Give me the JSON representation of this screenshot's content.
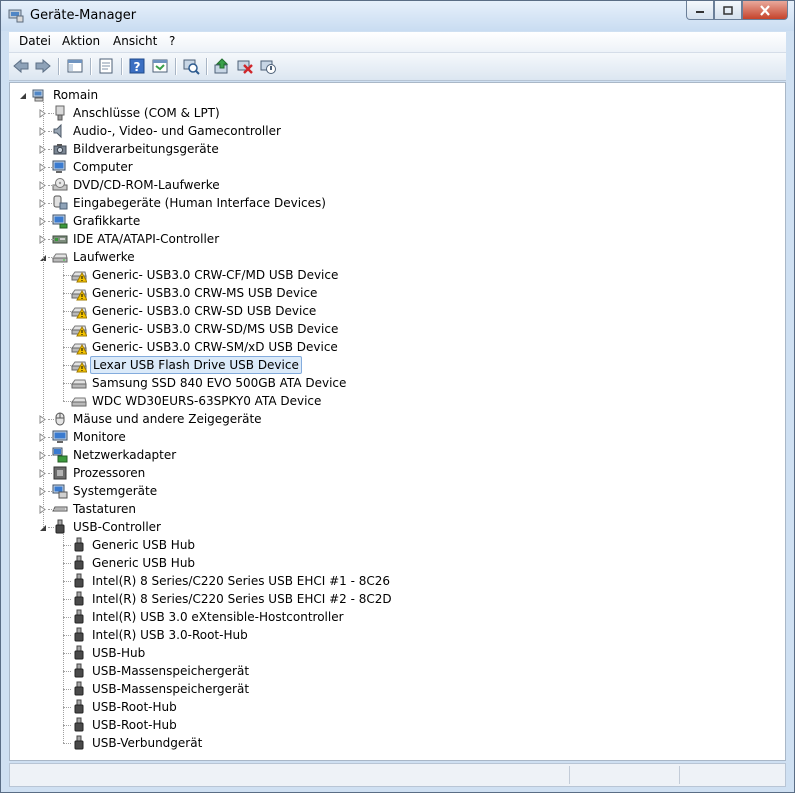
{
  "window": {
    "title": "Geräte-Manager"
  },
  "menu": [
    {
      "label": "Datei",
      "accel": "D"
    },
    {
      "label": "Aktion",
      "accel": "k"
    },
    {
      "label": "Ansicht",
      "accel": "A"
    },
    {
      "label": "?",
      "accel": "?"
    }
  ],
  "toolbar": {
    "buttons": [
      "back-icon",
      "forward-icon",
      "show-hide-console-tree-icon",
      "properties-icon",
      "help-icon",
      "action-pane-icon",
      "scan-hardware-icon",
      "update-driver-icon",
      "uninstall-icon",
      "disable-device-icon"
    ]
  },
  "tree": {
    "root": "Romain",
    "categories": [
      {
        "label": "Anschlüsse (COM & LPT)",
        "icon": "port-icon",
        "expanded": false
      },
      {
        "label": "Audio-, Video- und Gamecontroller",
        "icon": "speaker-icon",
        "expanded": false
      },
      {
        "label": "Bildverarbeitungsgeräte",
        "icon": "camera-icon",
        "expanded": false
      },
      {
        "label": "Computer",
        "icon": "computer-icon",
        "expanded": false
      },
      {
        "label": "DVD/CD-ROM-Laufwerke",
        "icon": "disc-drive-icon",
        "expanded": false
      },
      {
        "label": "Eingabegeräte (Human Interface Devices)",
        "icon": "hid-icon",
        "expanded": false
      },
      {
        "label": "Grafikkarte",
        "icon": "display-adapter-icon",
        "expanded": false
      },
      {
        "label": "IDE ATA/ATAPI-Controller",
        "icon": "ide-controller-icon",
        "expanded": false
      },
      {
        "label": "Laufwerke",
        "icon": "disk-drive-icon",
        "expanded": true,
        "children": [
          {
            "label": "Generic- USB3.0 CRW-CF/MD USB Device",
            "warning": true
          },
          {
            "label": "Generic- USB3.0 CRW-MS USB Device",
            "warning": true
          },
          {
            "label": "Generic- USB3.0 CRW-SD USB Device",
            "warning": true
          },
          {
            "label": "Generic- USB3.0 CRW-SD/MS USB Device",
            "warning": true
          },
          {
            "label": "Generic- USB3.0 CRW-SM/xD USB Device",
            "warning": true
          },
          {
            "label": "Lexar USB Flash Drive USB Device",
            "warning": true,
            "selected": true
          },
          {
            "label": "Samsung SSD 840 EVO 500GB ATA Device",
            "warning": false
          },
          {
            "label": "WDC WD30EURS-63SPKY0 ATA Device",
            "warning": false
          }
        ]
      },
      {
        "label": "Mäuse und andere Zeigegeräte",
        "icon": "mouse-icon",
        "expanded": false
      },
      {
        "label": "Monitore",
        "icon": "monitor-icon",
        "expanded": false
      },
      {
        "label": "Netzwerkadapter",
        "icon": "network-adapter-icon",
        "expanded": false
      },
      {
        "label": "Prozessoren",
        "icon": "processor-icon",
        "expanded": false
      },
      {
        "label": "Systemgeräte",
        "icon": "system-devices-icon",
        "expanded": false
      },
      {
        "label": "Tastaturen",
        "icon": "keyboard-icon",
        "expanded": false
      },
      {
        "label": "USB-Controller",
        "icon": "usb-icon",
        "expanded": true,
        "children": [
          {
            "label": "Generic USB Hub"
          },
          {
            "label": "Generic USB Hub"
          },
          {
            "label": "Intel(R) 8 Series/C220 Series  USB EHCI #1 - 8C26"
          },
          {
            "label": "Intel(R) 8 Series/C220 Series  USB EHCI #2 - 8C2D"
          },
          {
            "label": "Intel(R) USB 3.0 eXtensible-Hostcontroller"
          },
          {
            "label": "Intel(R) USB 3.0-Root-Hub"
          },
          {
            "label": "USB-Hub"
          },
          {
            "label": "USB-Massenspeichergerät"
          },
          {
            "label": "USB-Massenspeichergerät"
          },
          {
            "label": "USB-Root-Hub"
          },
          {
            "label": "USB-Root-Hub"
          },
          {
            "label": "USB-Verbundgerät"
          }
        ]
      }
    ]
  },
  "colors": {
    "selection": "#dbeaf9",
    "selection_border": "#84acdd",
    "warning": "#f5c400",
    "close_button": "#c5432b"
  }
}
